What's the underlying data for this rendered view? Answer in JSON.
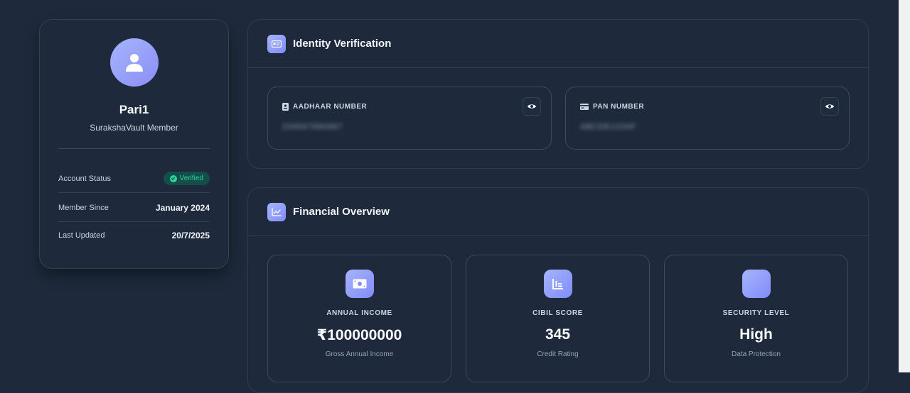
{
  "profile": {
    "username": "Pari1",
    "member_type": "SurakshaVault Member",
    "rows": [
      {
        "label": "Account Status",
        "value": "Verified"
      },
      {
        "label": "Member Since",
        "value": "January 2024"
      },
      {
        "label": "Last Updated",
        "value": "20/7/2025"
      }
    ]
  },
  "identity": {
    "title": "Identity Verification",
    "aadhaar": {
      "label": "AADHAAR NUMBER",
      "value": "234567890987"
    },
    "pan": {
      "label": "PAN NUMBER",
      "value": "ABCDE1234F"
    }
  },
  "financial": {
    "title": "Financial Overview",
    "cards": [
      {
        "label": "ANNUAL INCOME",
        "value": "₹100000000",
        "sub": "Gross Annual Income"
      },
      {
        "label": "CIBIL SCORE",
        "value": "345",
        "sub": "Credit Rating"
      },
      {
        "label": "SECURITY LEVEL",
        "value": "High",
        "sub": "Data Protection"
      }
    ]
  },
  "colors": {
    "background": "#1e293b",
    "accent": "#818cf8",
    "verified": "#34d399"
  }
}
